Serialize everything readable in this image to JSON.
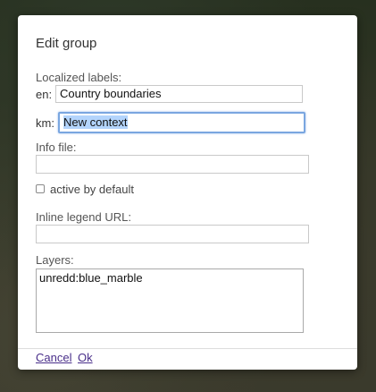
{
  "dialog": {
    "title": "Edit group",
    "localized_labels_label": "Localized labels:",
    "labels": [
      {
        "lang": "en:",
        "value": "Country boundaries"
      },
      {
        "lang": "km:",
        "value": "New context"
      }
    ],
    "info_file_label": "Info file:",
    "info_file_value": "",
    "active_by_default_label": "active by default",
    "inline_legend_label": "Inline legend URL:",
    "inline_legend_value": "",
    "layers_label": "Layers:",
    "layers_value": "unredd:blue_marble",
    "cancel_label": "Cancel",
    "ok_label": "Ok"
  },
  "colors": {
    "link": "#4a2f8a",
    "focus_border": "#7aa6e0",
    "selection": "#b3d4fc"
  }
}
